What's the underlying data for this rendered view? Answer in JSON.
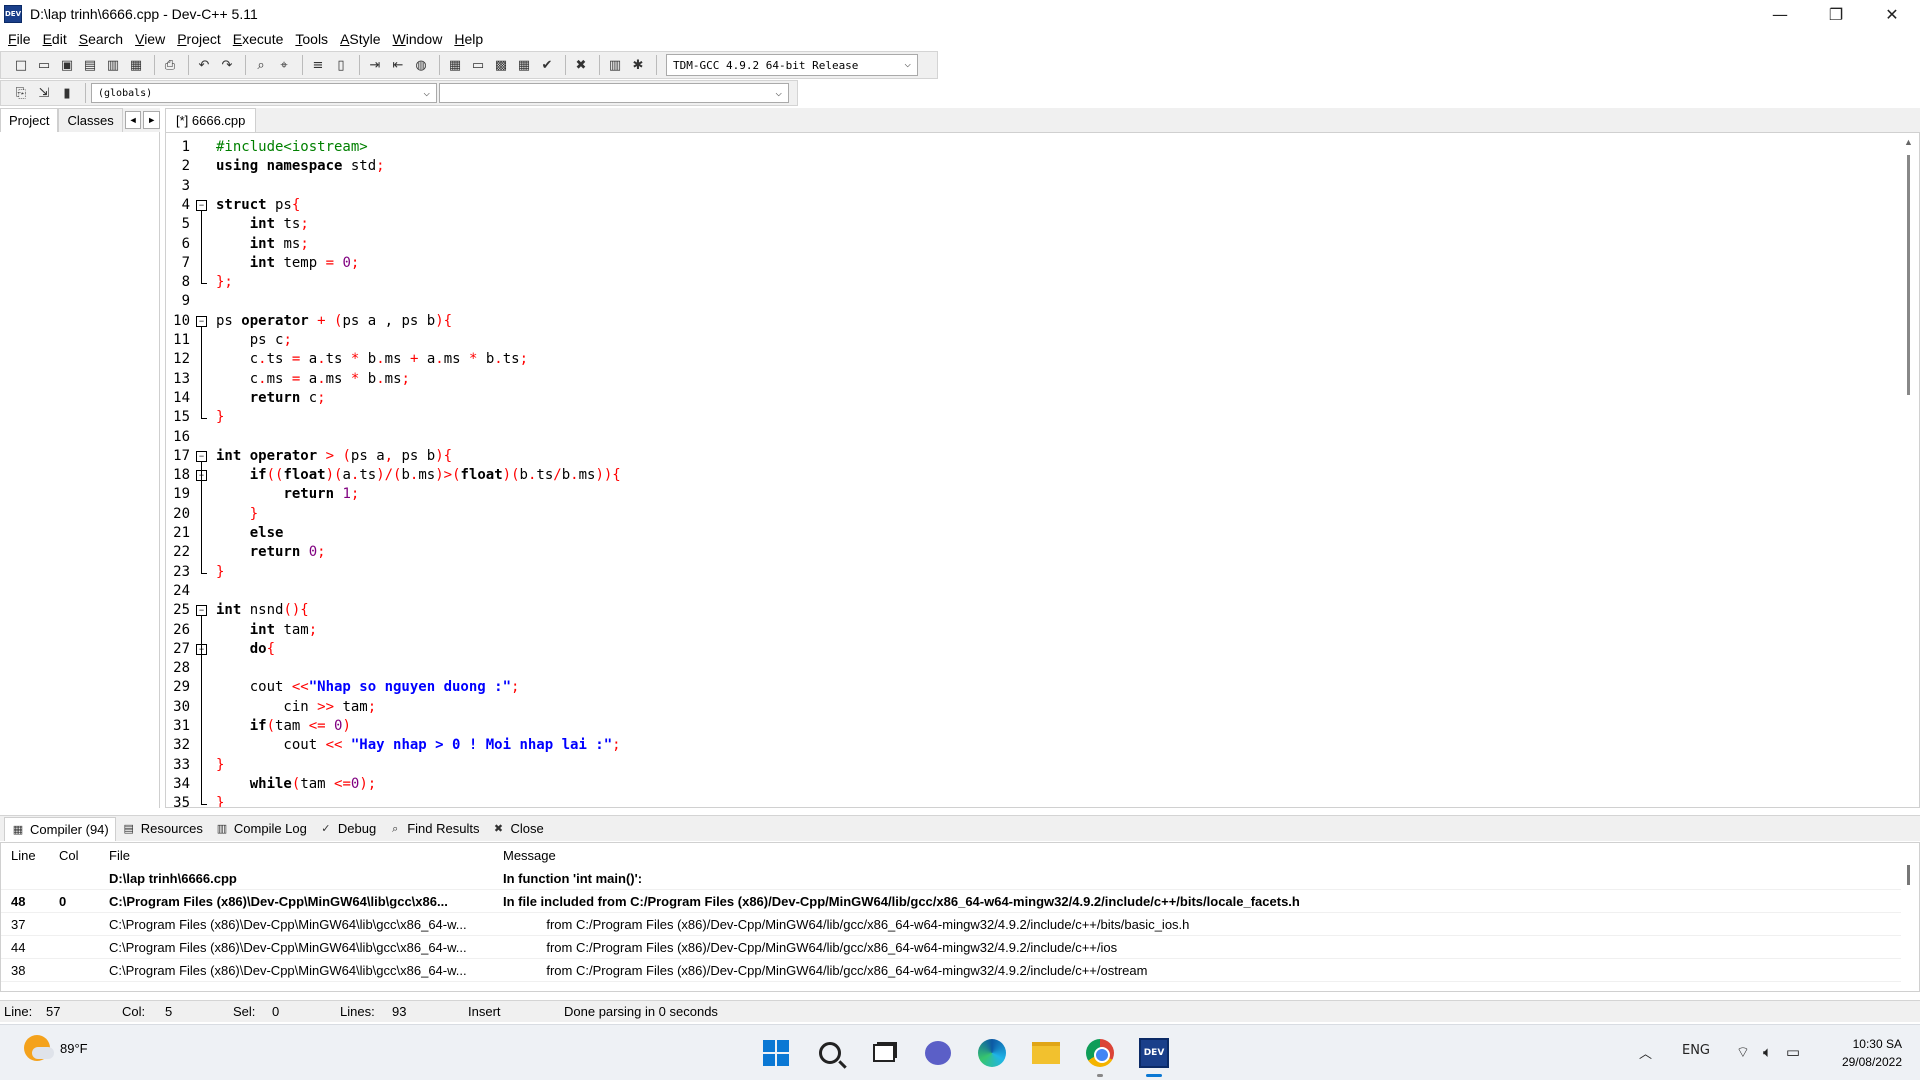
{
  "window": {
    "app_icon_text": "DEV",
    "title": "D:\\lap trinh\\6666.cpp - Dev-C++ 5.11",
    "minimize": "—",
    "restore": "❐",
    "close": "✕"
  },
  "menu": [
    {
      "mn": "F",
      "rest": "ile"
    },
    {
      "mn": "E",
      "rest": "dit"
    },
    {
      "mn": "S",
      "rest": "earch"
    },
    {
      "mn": "V",
      "rest": "iew"
    },
    {
      "mn": "P",
      "rest": "roject"
    },
    {
      "mn": "E",
      "rest": "xecute"
    },
    {
      "mn": "T",
      "rest": "ools"
    },
    {
      "mn": "A",
      "rest": "Style"
    },
    {
      "mn": "W",
      "rest": "indow"
    },
    {
      "mn": "H",
      "rest": "elp"
    }
  ],
  "toolbar": {
    "compiler": "TDM-GCC 4.9.2 64-bit Release",
    "scope": "(globals)",
    "members": ""
  },
  "left_panel": {
    "tabs": [
      "Project",
      "Classes"
    ],
    "arrow_left": "◄",
    "arrow_right": "►"
  },
  "editor": {
    "tab": "[*] 6666.cpp",
    "lines": [
      {
        "n": "1",
        "t": [
          [
            "pp",
            "#include<iostream>"
          ]
        ]
      },
      {
        "n": "2",
        "t": [
          [
            "kw",
            "using namespace"
          ],
          [
            "",
            " std"
          ],
          [
            "sym",
            ";"
          ]
        ]
      },
      {
        "n": "3",
        "t": []
      },
      {
        "n": "4",
        "t": [
          [
            "kw",
            "struct"
          ],
          [
            "",
            " ps"
          ],
          [
            "sym",
            "{"
          ]
        ]
      },
      {
        "n": "5",
        "t": [
          [
            "",
            "    "
          ],
          [
            "kw",
            "int"
          ],
          [
            "",
            " ts"
          ],
          [
            "sym",
            ";"
          ]
        ]
      },
      {
        "n": "6",
        "t": [
          [
            "",
            "    "
          ],
          [
            "kw",
            "int"
          ],
          [
            "",
            " ms"
          ],
          [
            "sym",
            ";"
          ]
        ]
      },
      {
        "n": "7",
        "t": [
          [
            "",
            "    "
          ],
          [
            "kw",
            "int"
          ],
          [
            "",
            " temp "
          ],
          [
            "sym",
            "="
          ],
          [
            "",
            " "
          ],
          [
            "num",
            "0"
          ],
          [
            "sym",
            ";"
          ]
        ]
      },
      {
        "n": "8",
        "t": [
          [
            "sym",
            "};"
          ]
        ]
      },
      {
        "n": "9",
        "t": []
      },
      {
        "n": "10",
        "t": [
          [
            "",
            "ps "
          ],
          [
            "kw",
            "operator"
          ],
          [
            "",
            " "
          ],
          [
            "sym",
            "+"
          ],
          [
            "",
            " "
          ],
          [
            "sym",
            "("
          ],
          [
            "",
            "ps a , ps b"
          ],
          [
            "sym",
            "){"
          ]
        ]
      },
      {
        "n": "11",
        "t": [
          [
            "",
            "    ps c"
          ],
          [
            "sym",
            ";"
          ]
        ]
      },
      {
        "n": "12",
        "t": [
          [
            "",
            "    c"
          ],
          [
            "sym",
            "."
          ],
          [
            "",
            "ts "
          ],
          [
            "sym",
            "="
          ],
          [
            "",
            " a"
          ],
          [
            "sym",
            "."
          ],
          [
            "",
            "ts "
          ],
          [
            "sym",
            "*"
          ],
          [
            "",
            " b"
          ],
          [
            "sym",
            "."
          ],
          [
            "",
            "ms "
          ],
          [
            "sym",
            "+"
          ],
          [
            "",
            " a"
          ],
          [
            "sym",
            "."
          ],
          [
            "",
            "ms "
          ],
          [
            "sym",
            "*"
          ],
          [
            "",
            " b"
          ],
          [
            "sym",
            "."
          ],
          [
            "",
            "ts"
          ],
          [
            "sym",
            ";"
          ]
        ]
      },
      {
        "n": "13",
        "t": [
          [
            "",
            "    c"
          ],
          [
            "sym",
            "."
          ],
          [
            "",
            "ms "
          ],
          [
            "sym",
            "="
          ],
          [
            "",
            " a"
          ],
          [
            "sym",
            "."
          ],
          [
            "",
            "ms "
          ],
          [
            "sym",
            "*"
          ],
          [
            "",
            " b"
          ],
          [
            "sym",
            "."
          ],
          [
            "",
            "ms"
          ],
          [
            "sym",
            ";"
          ]
        ]
      },
      {
        "n": "14",
        "t": [
          [
            "",
            "    "
          ],
          [
            "kw",
            "return"
          ],
          [
            "",
            " c"
          ],
          [
            "sym",
            ";"
          ]
        ]
      },
      {
        "n": "15",
        "t": [
          [
            "sym",
            "}"
          ]
        ]
      },
      {
        "n": "16",
        "t": []
      },
      {
        "n": "17",
        "t": [
          [
            "kw",
            "int operator"
          ],
          [
            "",
            " "
          ],
          [
            "sym",
            ">"
          ],
          [
            "",
            " "
          ],
          [
            "sym",
            "("
          ],
          [
            "",
            "ps a"
          ],
          [
            "sym",
            ","
          ],
          [
            "",
            " ps b"
          ],
          [
            "sym",
            "){"
          ]
        ]
      },
      {
        "n": "18",
        "t": [
          [
            "",
            "    "
          ],
          [
            "kw",
            "if"
          ],
          [
            "sym",
            "(("
          ],
          [
            "kw",
            "float"
          ],
          [
            "sym",
            ")("
          ],
          [
            "",
            "a"
          ],
          [
            "sym",
            "."
          ],
          [
            "",
            "ts"
          ],
          [
            "sym",
            ")/("
          ],
          [
            "",
            "b"
          ],
          [
            "sym",
            "."
          ],
          [
            "",
            "ms"
          ],
          [
            "sym",
            ")>("
          ],
          [
            "kw",
            "float"
          ],
          [
            "sym",
            ")("
          ],
          [
            "",
            "b"
          ],
          [
            "sym",
            "."
          ],
          [
            "",
            "ts"
          ],
          [
            "sym",
            "/"
          ],
          [
            "",
            "b"
          ],
          [
            "sym",
            "."
          ],
          [
            "",
            "ms"
          ],
          [
            "sym",
            ")){"
          ]
        ]
      },
      {
        "n": "19",
        "t": [
          [
            "",
            "        "
          ],
          [
            "kw",
            "return"
          ],
          [
            "",
            " "
          ],
          [
            "num",
            "1"
          ],
          [
            "sym",
            ";"
          ]
        ]
      },
      {
        "n": "20",
        "t": [
          [
            "",
            "    "
          ],
          [
            "sym",
            "}"
          ]
        ]
      },
      {
        "n": "21",
        "t": [
          [
            "",
            "    "
          ],
          [
            "kw",
            "else"
          ]
        ]
      },
      {
        "n": "22",
        "t": [
          [
            "",
            "    "
          ],
          [
            "kw",
            "return"
          ],
          [
            "",
            " "
          ],
          [
            "num",
            "0"
          ],
          [
            "sym",
            ";"
          ]
        ]
      },
      {
        "n": "23",
        "t": [
          [
            "sym",
            "}"
          ]
        ]
      },
      {
        "n": "24",
        "t": []
      },
      {
        "n": "25",
        "t": [
          [
            "kw",
            "int"
          ],
          [
            "",
            " nsnd"
          ],
          [
            "sym",
            "(){"
          ]
        ]
      },
      {
        "n": "26",
        "t": [
          [
            "",
            "    "
          ],
          [
            "kw",
            "int"
          ],
          [
            "",
            " tam"
          ],
          [
            "sym",
            ";"
          ]
        ]
      },
      {
        "n": "27",
        "t": [
          [
            "",
            "    "
          ],
          [
            "kw",
            "do"
          ],
          [
            "sym",
            "{"
          ]
        ]
      },
      {
        "n": "28",
        "t": []
      },
      {
        "n": "29",
        "t": [
          [
            "",
            "    cout "
          ],
          [
            "sym",
            "<<"
          ],
          [
            "str",
            "\"Nhap so nguyen duong :\""
          ],
          [
            "sym",
            ";"
          ]
        ]
      },
      {
        "n": "30",
        "t": [
          [
            "",
            "        cin "
          ],
          [
            "sym",
            ">>"
          ],
          [
            "",
            " tam"
          ],
          [
            "sym",
            ";"
          ]
        ]
      },
      {
        "n": "31",
        "t": [
          [
            "",
            "    "
          ],
          [
            "kw",
            "if"
          ],
          [
            "sym",
            "("
          ],
          [
            "",
            "tam "
          ],
          [
            "sym",
            "<="
          ],
          [
            "",
            " "
          ],
          [
            "num",
            "0"
          ],
          [
            "sym",
            ")"
          ]
        ]
      },
      {
        "n": "32",
        "t": [
          [
            "",
            "        cout "
          ],
          [
            "sym",
            "<<"
          ],
          [
            "",
            " "
          ],
          [
            "str",
            "\"Hay nhap > 0 ! Moi nhap lai :\""
          ],
          [
            "sym",
            ";"
          ]
        ]
      },
      {
        "n": "33",
        "t": [
          [
            "sym",
            "}"
          ]
        ]
      },
      {
        "n": "34",
        "t": [
          [
            "",
            "    "
          ],
          [
            "kw",
            "while"
          ],
          [
            "sym",
            "("
          ],
          [
            "",
            "tam "
          ],
          [
            "sym",
            "<="
          ],
          [
            "num",
            "0"
          ],
          [
            "sym",
            ");"
          ]
        ]
      },
      {
        "n": "35",
        "t": [
          [
            "sym",
            "}"
          ]
        ]
      }
    ]
  },
  "bottom_tabs": [
    {
      "icon": "compiler-icon",
      "glyph": "▦",
      "label": "Compiler (94)"
    },
    {
      "icon": "resources-icon",
      "glyph": "▤",
      "label": "Resources"
    },
    {
      "icon": "compile-log-icon",
      "glyph": "▥",
      "label": "Compile Log"
    },
    {
      "icon": "debug-icon",
      "glyph": "✓",
      "label": "Debug"
    },
    {
      "icon": "find-results-icon",
      "glyph": "⌕",
      "label": "Find Results"
    },
    {
      "icon": "close-icon",
      "glyph": "✖",
      "label": "Close"
    }
  ],
  "messages": {
    "headers": {
      "line": "Line",
      "col": "Col",
      "file": "File",
      "message": "Message"
    },
    "rows": [
      {
        "line": "",
        "col": "",
        "file": "D:\\lap trinh\\6666.cpp",
        "message": "In function 'int main()':",
        "bold": true
      },
      {
        "line": "48",
        "col": "0",
        "file": "C:\\Program Files (x86)\\Dev-Cpp\\MinGW64\\lib\\gcc\\x86...",
        "message": "In file included from C:/Program Files (x86)/Dev-Cpp/MinGW64/lib/gcc/x86_64-w64-mingw32/4.9.2/include/c++/bits/locale_facets.h",
        "bold": true
      },
      {
        "line": "37",
        "col": "",
        "file": "C:\\Program Files (x86)\\Dev-Cpp\\MinGW64\\lib\\gcc\\x86_64-w...",
        "message": "            from C:/Program Files (x86)/Dev-Cpp/MinGW64/lib/gcc/x86_64-w64-mingw32/4.9.2/include/c++/bits/basic_ios.h",
        "bold": false
      },
      {
        "line": "44",
        "col": "",
        "file": "C:\\Program Files (x86)\\Dev-Cpp\\MinGW64\\lib\\gcc\\x86_64-w...",
        "message": "            from C:/Program Files (x86)/Dev-Cpp/MinGW64/lib/gcc/x86_64-w64-mingw32/4.9.2/include/c++/ios",
        "bold": false
      },
      {
        "line": "38",
        "col": "",
        "file": "C:\\Program Files (x86)\\Dev-Cpp\\MinGW64\\lib\\gcc\\x86_64-w...",
        "message": "            from C:/Program Files (x86)/Dev-Cpp/MinGW64/lib/gcc/x86_64-w64-mingw32/4.9.2/include/c++/ostream",
        "bold": false
      }
    ]
  },
  "status": {
    "line_label": "Line:",
    "line": "57",
    "col_label": "Col:",
    "col": "5",
    "sel_label": "Sel:",
    "sel": "0",
    "lines_label": "Lines:",
    "lines": "93",
    "mode": "Insert",
    "message": "Done parsing in 0 seconds"
  },
  "taskbar": {
    "temperature": "89°F",
    "lang": "ENG",
    "time": "10:30 SA",
    "date": "29/08/2022",
    "chevron": "︿"
  },
  "colors": {
    "keyword": "#000000",
    "preprocessor": "#008000",
    "symbol": "#ff0000",
    "number": "#800080",
    "string": "#0000ff"
  }
}
